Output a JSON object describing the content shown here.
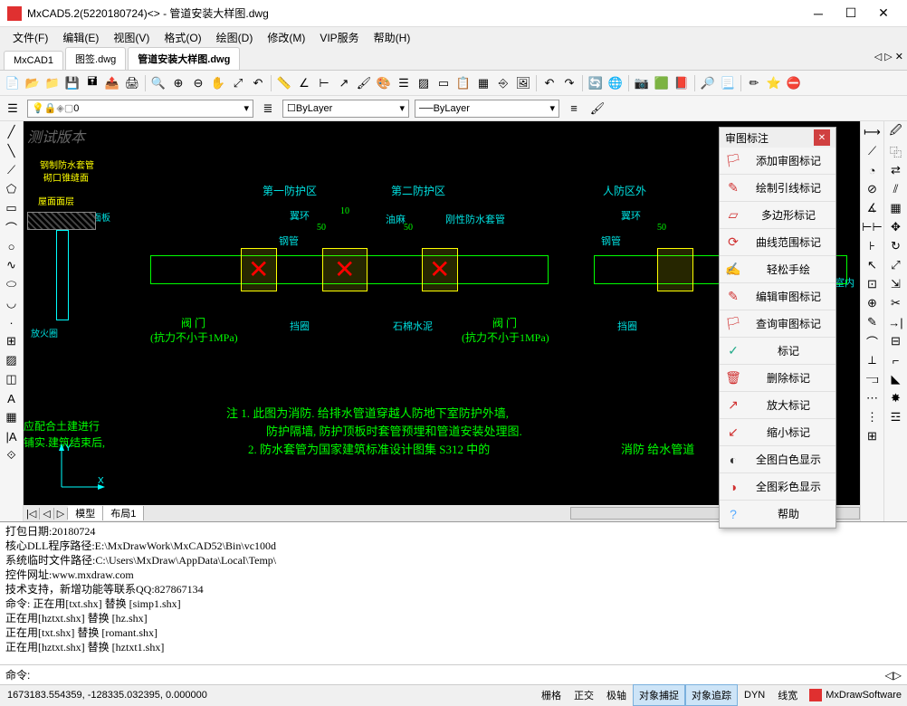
{
  "window": {
    "title": "MxCAD5.2(5220180724)<> - 管道安装大样图.dwg"
  },
  "menus": [
    "文件(F)",
    "编辑(E)",
    "视图(V)",
    "格式(O)",
    "绘图(D)",
    "修改(M)",
    "VIP服务",
    "帮助(H)"
  ],
  "tabs": [
    {
      "label": "MxCAD1",
      "active": false
    },
    {
      "label": "图签.dwg",
      "active": false
    },
    {
      "label": "管道安装大样图.dwg",
      "active": true
    }
  ],
  "layer_row": {
    "layer": "0",
    "color": "ByLayer",
    "linetype": "ByLayer"
  },
  "review_panel": {
    "title": "审图标注",
    "items": [
      {
        "icon": "🏳",
        "label": "添加审图标记",
        "color": "#d03030"
      },
      {
        "icon": "✎",
        "label": "绘制引线标记",
        "color": "#d03030"
      },
      {
        "icon": "▱",
        "label": "多边形标记",
        "color": "#d03030"
      },
      {
        "icon": "⟳",
        "label": "曲线范围标记",
        "color": "#d03030"
      },
      {
        "icon": "✍",
        "label": "轻松手绘",
        "color": "#888"
      },
      {
        "icon": "✎",
        "label": "编辑审图标记",
        "color": "#d03030"
      },
      {
        "icon": "🏳",
        "label": "查询审图标记",
        "color": "#d03030"
      },
      {
        "icon": "✓",
        "label": "标记",
        "color": "#2a8"
      },
      {
        "icon": "🗑",
        "label": "删除标记",
        "color": "#d03030"
      },
      {
        "icon": "↗",
        "label": "放大标记",
        "color": "#d03030"
      },
      {
        "icon": "↙",
        "label": "缩小标记",
        "color": "#d03030"
      },
      {
        "icon": "◐",
        "label": "全图白色显示",
        "color": "#333"
      },
      {
        "icon": "◑",
        "label": "全图彩色显示",
        "color": "#d03030"
      },
      {
        "icon": "?",
        "label": "帮助",
        "color": "#5af"
      }
    ]
  },
  "canvas_labels": {
    "watermark": "测试版本",
    "l1": "钢制防水套管",
    "l2": "砌口锥缝面",
    "l3": "屋面面层",
    "l4": "屋面板",
    "l5": "放火圈",
    "l6": "应配合土建进行",
    "l7": "铺实.建筑结束后,",
    "zone1": "第一防护区",
    "zone2": "第二防护区",
    "outer": "人防区外",
    "ring": "翼环",
    "pipe": "钢管",
    "oil": "油麻",
    "sleeve": "刚性防水套管",
    "d10": "10",
    "d50a": "50",
    "d50b": "50",
    "valve": "阀 门",
    "res": "(抗力不小于1MPa)",
    "block": "挡圈",
    "cement": "石棉水泥",
    "room": "室内",
    "note1": "注 1. 此图为消防. 给排水管道穿越人防地下室防护外墙,",
    "note2": "防护隔墙, 防护顶板时套管预埋和管道安装处理图.",
    "note3": "2. 防水套管为国家建筑标准设计图集 S312 中的",
    "note4": "消防 给水管道"
  },
  "model_tabs": [
    "模型",
    "布局1"
  ],
  "cmd_lines": [
    "打包日期:20180724",
    "核心DLL程序路径:E:\\MxDrawWork\\MxCAD52\\Bin\\vc100d",
    "系统临时文件路径:C:\\Users\\MxDraw\\AppData\\Local\\Temp\\",
    "控件网址:www.mxdraw.com",
    "技术支持，新增功能等联系QQ:827867134",
    "命令: 正在用[txt.shx] 替换 [simp1.shx]",
    "正在用[hztxt.shx] 替换 [hz.shx]",
    "正在用[txt.shx] 替换 [romant.shx]",
    "正在用[hztxt.shx] 替换 [hztxt1.shx]"
  ],
  "cmd_prompt": "命令:",
  "status": {
    "coords": "1673183.554359,  -128335.032395,  0.000000",
    "buttons": [
      {
        "label": "栅格",
        "active": false
      },
      {
        "label": "正交",
        "active": false
      },
      {
        "label": "极轴",
        "active": false
      },
      {
        "label": "对象捕捉",
        "active": true
      },
      {
        "label": "对象追踪",
        "active": true
      },
      {
        "label": "DYN",
        "active": false
      },
      {
        "label": "线宽",
        "active": false
      }
    ],
    "brand": "MxDrawSoftware"
  }
}
